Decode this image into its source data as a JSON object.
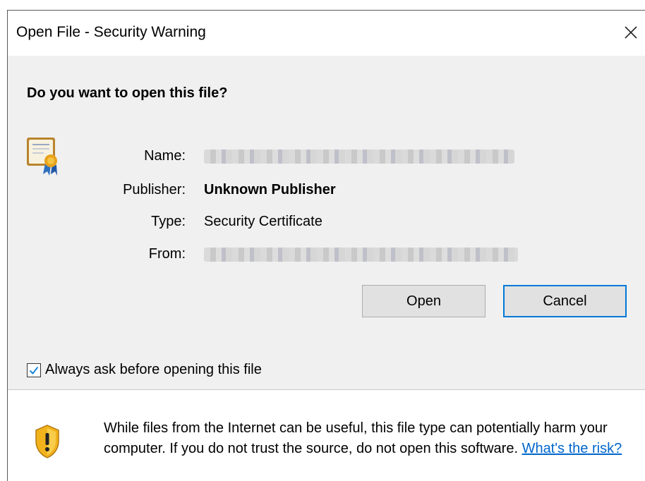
{
  "window": {
    "title": "Open File - Security Warning"
  },
  "main": {
    "question": "Do you want to open this file?",
    "fields": {
      "name_label": "Name:",
      "publisher_label": "Publisher:",
      "publisher_value": "Unknown Publisher",
      "type_label": "Type:",
      "type_value": "Security Certificate",
      "from_label": "From:"
    },
    "buttons": {
      "open": "Open",
      "cancel": "Cancel"
    },
    "checkbox": {
      "label": "Always ask before opening this file",
      "checked": true
    }
  },
  "footer": {
    "warning_text": "While files from the Internet can be useful, this file type can potentially harm your computer. If you do not trust the source, do not open this software. ",
    "risk_link": "What's the risk?"
  },
  "colors": {
    "accent": "#0078d7",
    "link": "#0066cc",
    "panel": "#f0f0f0",
    "shield": "#f2b21b"
  },
  "icons": {
    "close": "close-icon",
    "certificate": "certificate-icon",
    "shield": "warning-shield-icon",
    "check": "checkmark-icon"
  }
}
